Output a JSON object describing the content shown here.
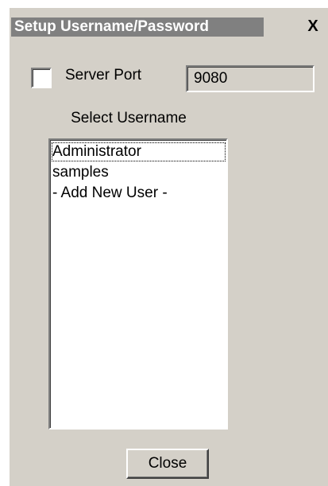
{
  "window": {
    "title": "Setup Username/Password",
    "close_glyph": "X"
  },
  "server_port": {
    "checkbox_checked": false,
    "label": "Server Port",
    "value": "9080"
  },
  "username_list": {
    "label": "Select Username",
    "items": [
      {
        "label": "Administrator",
        "selected": true
      },
      {
        "label": "samples",
        "selected": false
      },
      {
        "label": "- Add New User -",
        "selected": false
      }
    ]
  },
  "buttons": {
    "close_label": "Close"
  }
}
